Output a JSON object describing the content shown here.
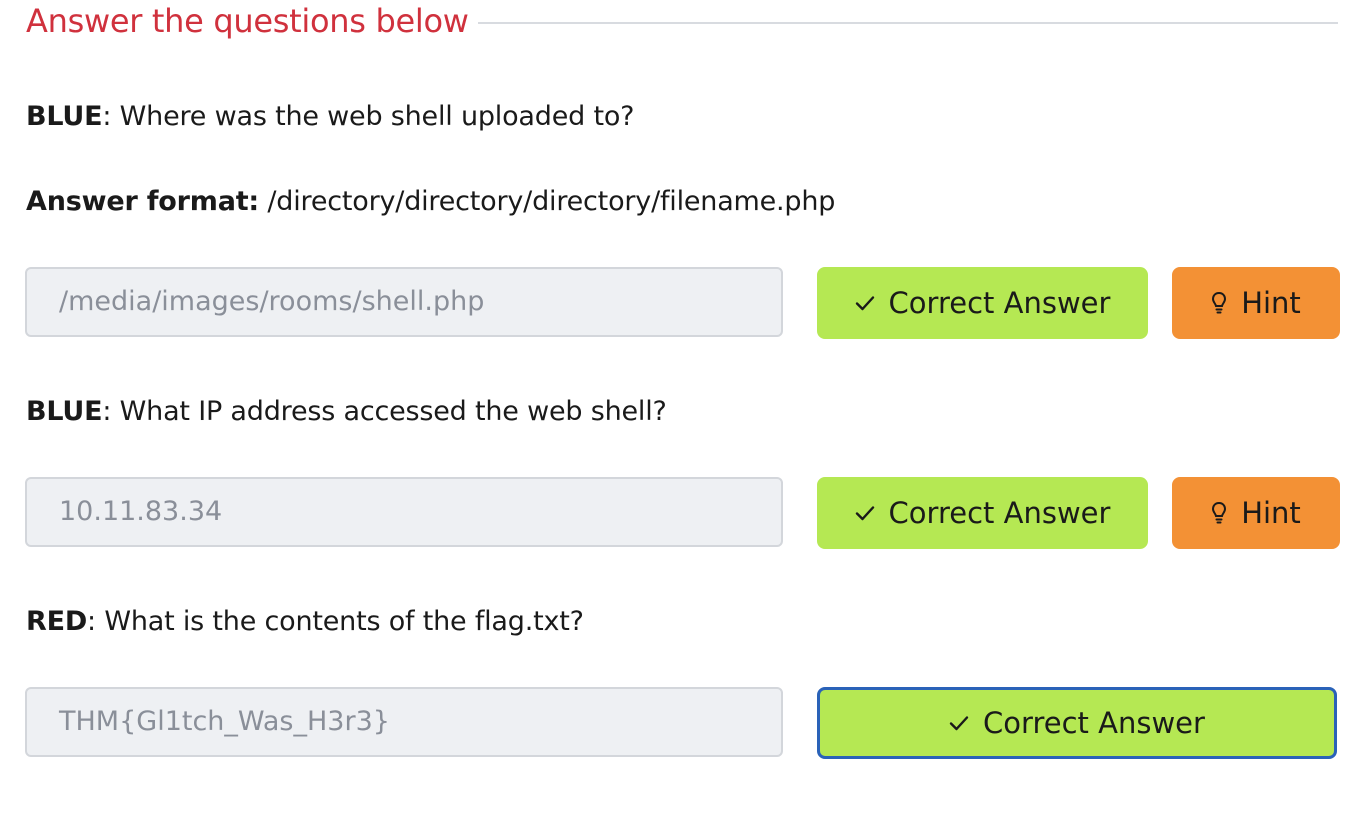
{
  "section": {
    "title": "Answer the questions below"
  },
  "questions": [
    {
      "team": "BLUE",
      "prompt": ": Where was the web shell uploaded to?",
      "format_label": "Answer format:",
      "format_value": " /directory/directory/directory/filename.php",
      "answer": "/media/images/rooms/shell.php",
      "submit_label": "Correct Answer",
      "hint_label": "Hint"
    },
    {
      "team": "BLUE",
      "prompt": ": What IP address accessed the web shell?",
      "answer": "10.11.83.34",
      "submit_label": "Correct Answer",
      "hint_label": "Hint"
    },
    {
      "team": "RED",
      "prompt": ": What is the contents of the flag.txt?",
      "answer": "THM{Gl1tch_Was_H3r3}",
      "submit_label": "Correct Answer"
    }
  ],
  "colors": {
    "title": "#d0313d",
    "correct": "#b5e853",
    "hint": "#f39135",
    "focus_ring": "#2a62b8"
  },
  "icons": {
    "correct": "check-icon",
    "hint": "lightbulb-icon"
  }
}
